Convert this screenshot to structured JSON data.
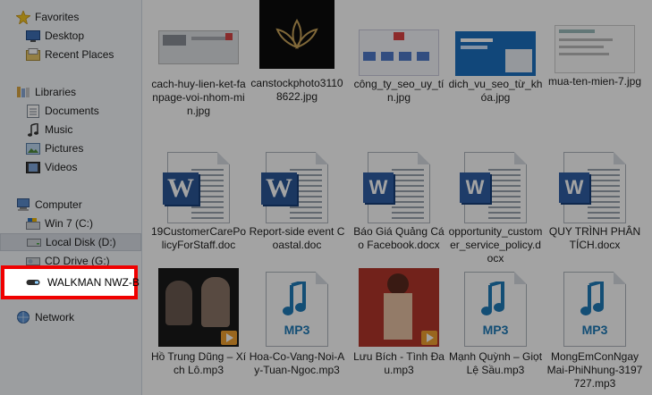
{
  "nav": {
    "favorites": "Favorites",
    "desktop": "Desktop",
    "recent_places": "Recent Places",
    "libraries": "Libraries",
    "documents": "Documents",
    "music": "Music",
    "pictures": "Pictures",
    "videos": "Videos",
    "computer": "Computer",
    "win7": "Win 7 (C:)",
    "local_disk": "Local Disk (D:)",
    "cd_drive": "CD Drive (G:)",
    "walkman": "WALKMAN NWZ-B",
    "network": "Network"
  },
  "files": [
    {
      "name": "cach-huy-lien-ket-fanpage-voi-nhom-min.jpg",
      "kind": "image"
    },
    {
      "name": "canstockphoto31108622.jpg",
      "kind": "image"
    },
    {
      "name": "công_ty_seo_uy_tín.jpg",
      "kind": "image"
    },
    {
      "name": "dich_vu_seo_từ_khóa.jpg",
      "kind": "image"
    },
    {
      "name": "mua-ten-mien-7.jpg",
      "kind": "image"
    },
    {
      "name": "19CustomerCarePolicyForStaff.doc",
      "kind": "doc"
    },
    {
      "name": "Report-side event Coastal.doc",
      "kind": "doc"
    },
    {
      "name": "Báo Giá Quảng Cáo Facebook.docx",
      "kind": "docx"
    },
    {
      "name": "opportunity_customer_service_policy.docx",
      "kind": "docx"
    },
    {
      "name": "QUY TRÌNH PHÂN TÍCH.docx",
      "kind": "docx"
    },
    {
      "name": "Hồ Trung Dũng – Xích Lô.mp3",
      "kind": "mp3-art"
    },
    {
      "name": "Hoa-Co-Vang-Noi-Ay-Tuan-Ngoc.mp3",
      "kind": "mp3"
    },
    {
      "name": "Lưu Bích - Tình Đau.mp3",
      "kind": "mp3-art"
    },
    {
      "name": "Mạnh Quỳnh – Giọt Lệ Sầu.mp3",
      "kind": "mp3"
    },
    {
      "name": "MongEmConNgayMai-PhiNhung-3197727.mp3",
      "kind": "mp3"
    }
  ],
  "icons": {
    "star": "star-icon",
    "desktop": "desktop-icon",
    "recent": "recent-places-icon",
    "library": "libraries-icon",
    "docs": "documents-icon",
    "music": "music-icon",
    "pictures": "pictures-icon",
    "videos": "videos-icon",
    "computer": "computer-icon",
    "drive": "drive-icon",
    "cd": "cd-drive-icon",
    "walkman": "walkman-device-icon",
    "network": "network-icon"
  },
  "colors": {
    "highlight_border": "#f00000",
    "word_blue": "#2b5797",
    "mp3_blue": "#1f7ab8"
  }
}
